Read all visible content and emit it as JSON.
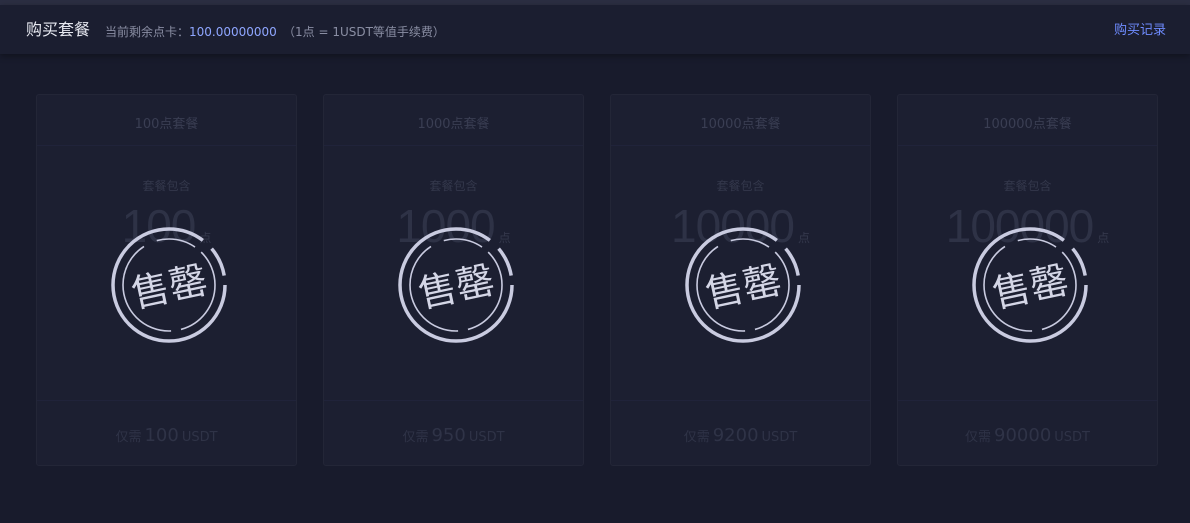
{
  "header": {
    "title": "购买套餐",
    "balance_label": "当前剩余点卡：",
    "balance_value": "100.00000000",
    "rate_note": "（1点 = 1USDT等值手续费）",
    "history_link": "购买记录"
  },
  "colors": {
    "background": "#181b2c",
    "header": "#1b1e30",
    "accent_blue": "#6f8cff",
    "stamp": "#c9cbe0"
  },
  "packages": [
    {
      "name": "100点套餐",
      "include_label": "套餐包含",
      "points": "100",
      "points_unit": "点",
      "price_prefix": "仅需",
      "price": "100",
      "currency": "USDT",
      "stamp_text": "售罄"
    },
    {
      "name": "1000点套餐",
      "include_label": "套餐包含",
      "points": "1000",
      "points_unit": "点",
      "price_prefix": "仅需",
      "price": "950",
      "currency": "USDT",
      "stamp_text": "售罄"
    },
    {
      "name": "10000点套餐",
      "include_label": "套餐包含",
      "points": "10000",
      "points_unit": "点",
      "price_prefix": "仅需",
      "price": "9200",
      "currency": "USDT",
      "stamp_text": "售罄"
    },
    {
      "name": "100000点套餐",
      "include_label": "套餐包含",
      "points": "100000",
      "points_unit": "点",
      "price_prefix": "仅需",
      "price": "90000",
      "currency": "USDT",
      "stamp_text": "售罄"
    }
  ]
}
